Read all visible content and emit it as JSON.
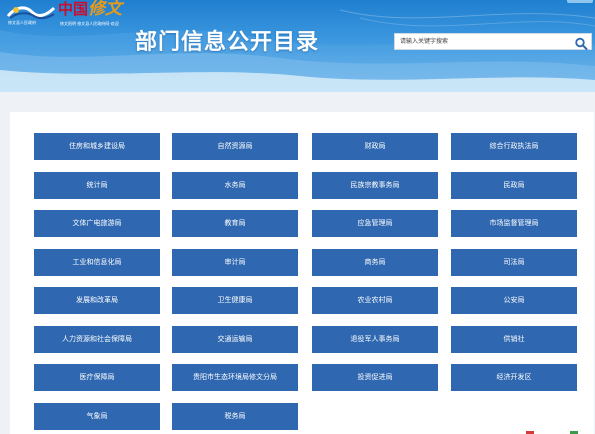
{
  "header": {
    "logo_main": "中国",
    "logo_swirl": "修文",
    "logo_sub_left": "修文县人民政府",
    "logo_sub_right": "修文阳明   修文县人民政府网-欢迎",
    "page_title": "部门信息公开目录"
  },
  "search": {
    "placeholder": "请输入关键字搜索"
  },
  "departments": [
    "住房和城乡建设局",
    "自然资源局",
    "财政局",
    "综合行政执法局",
    "统计局",
    "水务局",
    "民族宗教事务局",
    "民政局",
    "文体广电旅游局",
    "教育局",
    "应急管理局",
    "市场监督管理局",
    "工业和信息化局",
    "审计局",
    "商务局",
    "司法局",
    "发展和改革局",
    "卫生健康局",
    "农业农村局",
    "公安局",
    "人力资源和社会保障局",
    "交通运输局",
    "退役军人事务局",
    "供销社",
    "医疗保障局",
    "贵阳市生态环境局修文分局",
    "投资促进局",
    "经济开发区",
    "气象局",
    "税务局"
  ],
  "colors": {
    "banner": "#2a86d4",
    "button": "#2f68b1",
    "panel": "#ffffff",
    "page_bg": "#eef1f5"
  },
  "icons": {
    "search": "search-icon",
    "emblem": "logo-emblem-icon"
  }
}
